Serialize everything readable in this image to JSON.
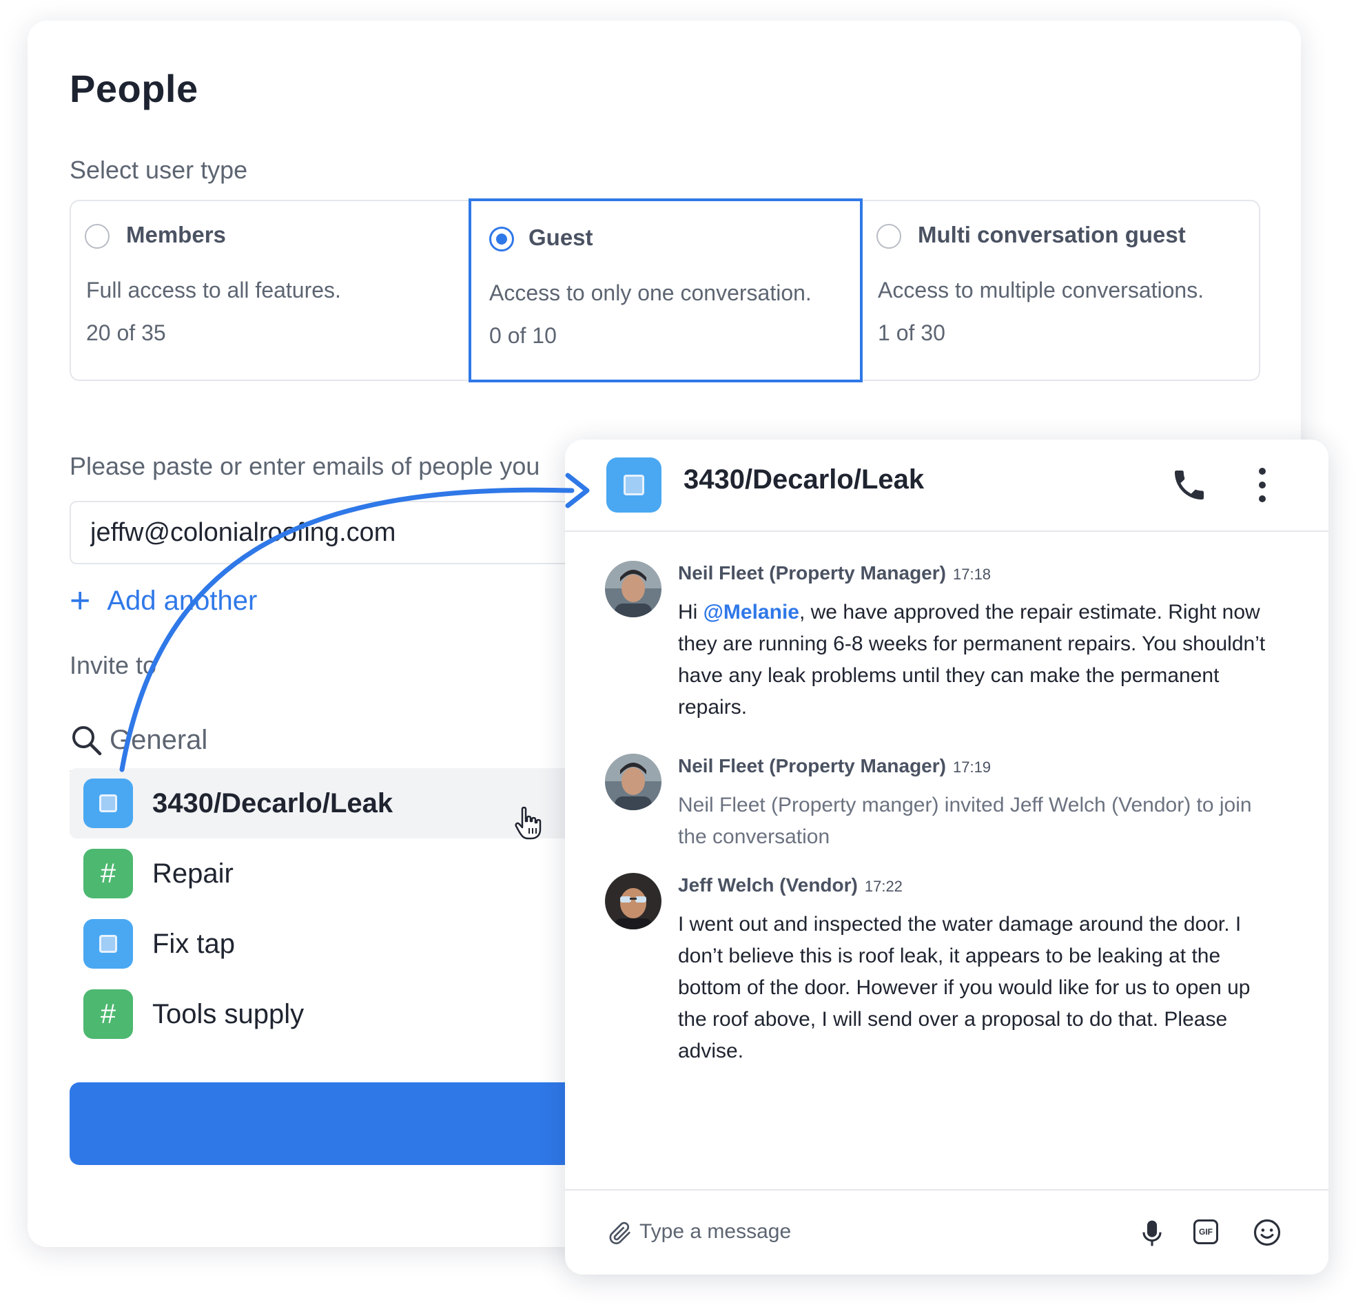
{
  "people": {
    "title": "People",
    "select_user_type_label": "Select user type",
    "user_types": [
      {
        "name": "Members",
        "description": "Full access to all features.",
        "count": "20 of 35",
        "selected": false
      },
      {
        "name": "Guest",
        "description": "Access to only one conversation.",
        "count": "0 of 10",
        "selected": true
      },
      {
        "name": "Multi conversation guest",
        "description": "Access to multiple conversations.",
        "count": "1 of 30",
        "selected": false
      }
    ],
    "emails_label": "Please paste or enter emails of people you",
    "email_value": "jeffw@colonialroofing.com",
    "add_another_label": "Add another",
    "invite_label": "Invite to",
    "search_placeholder": "General",
    "channels": [
      {
        "name": "3430/Decarlo/Leak",
        "icon": "conversation-icon",
        "selected": true
      },
      {
        "name": "Repair",
        "icon": "hash-icon",
        "selected": false
      },
      {
        "name": "Fix tap",
        "icon": "conversation-icon",
        "selected": false
      },
      {
        "name": "Tools supply",
        "icon": "hash-icon",
        "selected": false
      }
    ]
  },
  "conversation": {
    "title": "3430/Decarlo/Leak",
    "messages": [
      {
        "author": "Neil Fleet (Property Manager)",
        "time": "17:18",
        "mention": "@Melanie",
        "text_before": "Hi ",
        "text_after": ", we have approved the repair estimate. Right now they are running 6-8 weeks for permanent repairs. You shouldn’t have any leak problems until they can make the permanent repairs."
      },
      {
        "author": "Neil Fleet (Property Manager)",
        "time": "17:19",
        "text": "Neil Fleet (Property manger) invited Jeff Welch (Vendor) to join the conversation"
      },
      {
        "author": "Jeff Welch (Vendor)",
        "time": "17:22",
        "text": "I went out and inspected the water damage around the door. I don’t believe this is roof leak, it appears to be leaking at the bottom of the door. However if you would like for us to open up the roof above, I will send over a proposal to do that. Please advise."
      }
    ],
    "composer_placeholder": "Type a message",
    "gif_label": "GIF"
  },
  "colors": {
    "accent": "#2f78e8",
    "conversation_icon": "#4aa8f2",
    "channel_hash_icon": "#4db870"
  }
}
